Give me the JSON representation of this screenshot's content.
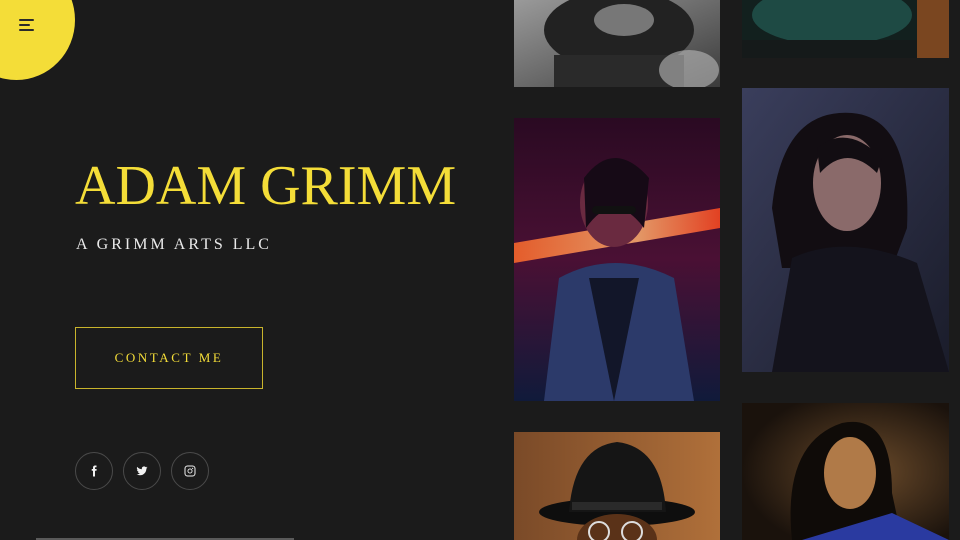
{
  "hero": {
    "title": "ADAM GRIMM",
    "subtitle": "A GRIMM ARTS LLC",
    "cta_label": "CONTACT ME"
  },
  "menu": {
    "icon": "hamburger-icon"
  },
  "socials": [
    {
      "icon": "facebook-icon"
    },
    {
      "icon": "twitter-icon"
    },
    {
      "icon": "instagram-icon"
    }
  ],
  "colors": {
    "accent": "#f4dd38",
    "background": "#1b1b1b",
    "text": "#eaeaea"
  },
  "gallery": [
    {
      "description": "tattooed-person-monochrome"
    },
    {
      "description": "teal-portrait"
    },
    {
      "description": "neon-light-portrait"
    },
    {
      "description": "woman-dark-blue-portrait"
    },
    {
      "description": "man-in-hat-with-glasses"
    },
    {
      "description": "woman-golden-light-portrait"
    }
  ]
}
